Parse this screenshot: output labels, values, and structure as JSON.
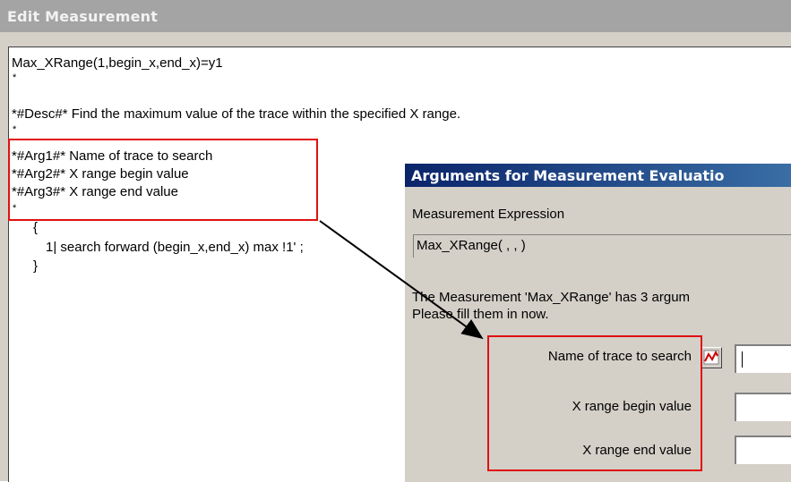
{
  "edit_window": {
    "title": "Edit Measurement",
    "lines": {
      "l1": "Max_XRange(1,begin_x,end_x)=y1",
      "l2": "*#Desc#* Find the maximum value of the trace within the specified X range.",
      "l3": "*#Arg1#* Name of trace to search",
      "l4": "*#Arg2#* X range begin value",
      "l5": "*#Arg3#* X range end value",
      "l6": "{",
      "l7": "1| search forward (begin_x,end_x) max !1' ;",
      "l8": "}"
    }
  },
  "args_dialog": {
    "title": "Arguments for Measurement Evaluatio",
    "expr_label": "Measurement Expression",
    "expr_value": "Max_XRange( , , )",
    "info_line1": "The Measurement 'Max_XRange' has 3 argum",
    "info_line2": "Please fill them in now.",
    "arg1_label": "Name of trace to search",
    "arg2_label": "X range begin value",
    "arg3_label": "X range end value"
  },
  "colors": {
    "highlight": "#e01010",
    "dialog_title": "#0a246a",
    "window_title": "#a4a4a4"
  },
  "icons": [
    "trace-browse-icon"
  ]
}
